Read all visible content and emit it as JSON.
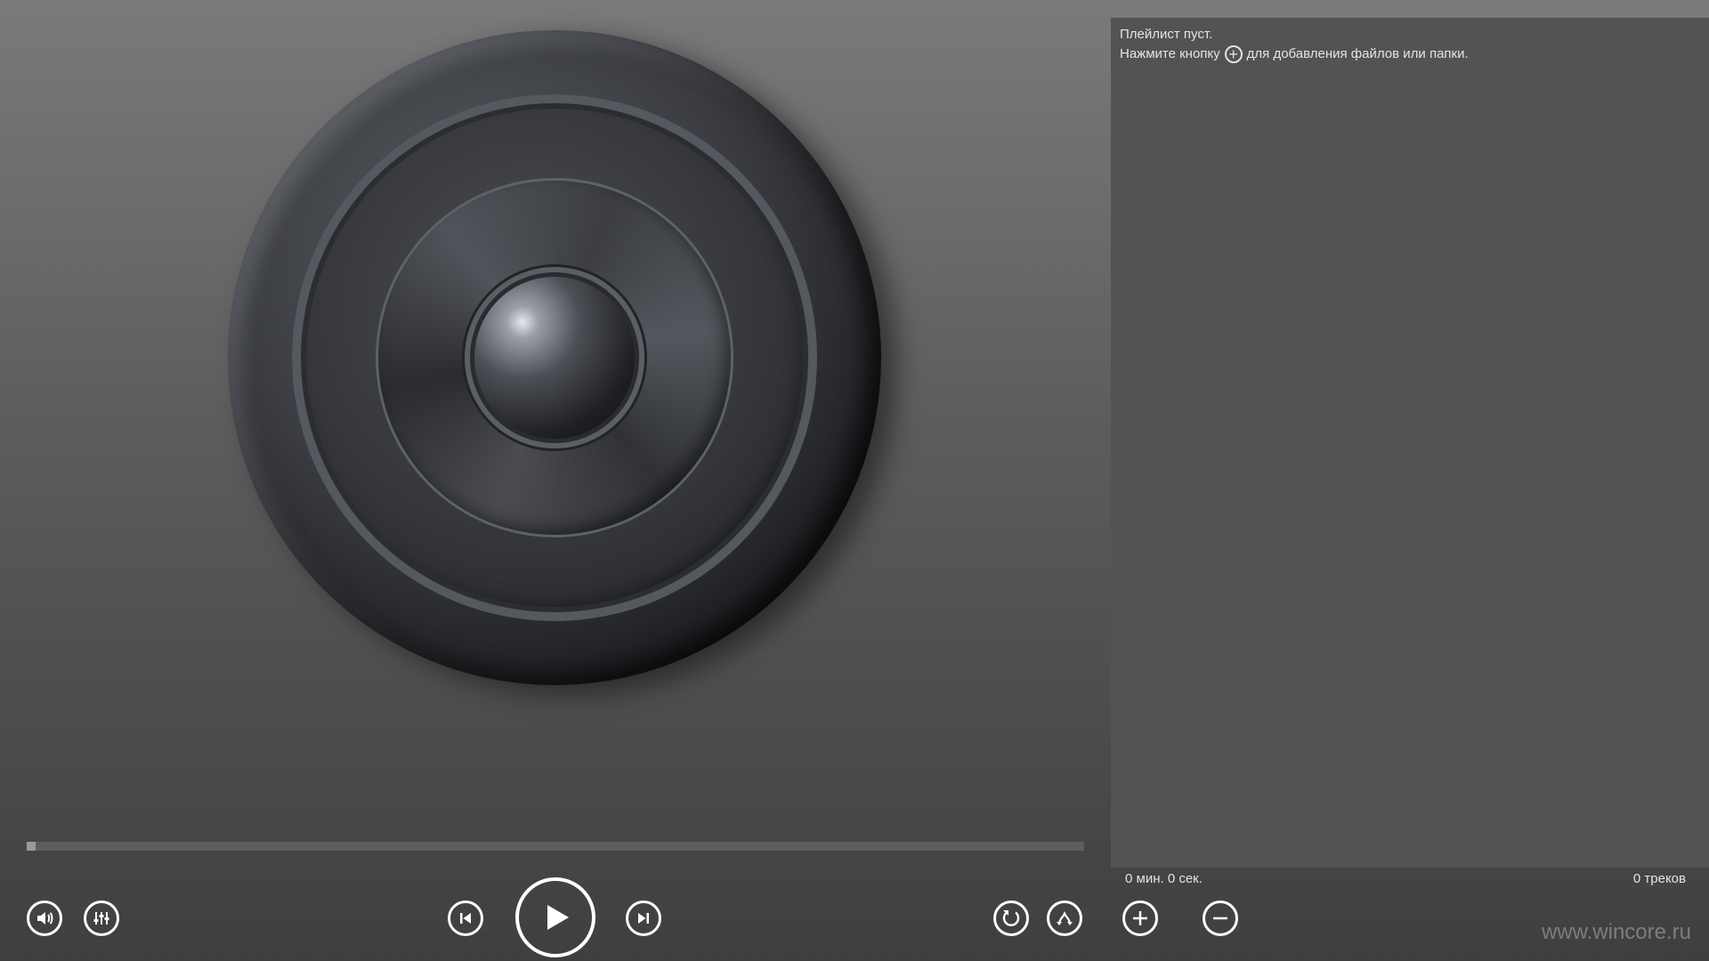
{
  "playlist": {
    "empty_text": "Плейлист пуст.",
    "hint_before": "Нажмите кнопку",
    "hint_icon": "plus-circle-icon",
    "hint_after": "для добавления файлов или папки.",
    "total_time": "0 мин. 0 сек.",
    "track_count": "0 треков"
  },
  "controls": {
    "volume_icon": "volume-icon",
    "equalizer_icon": "equalizer-icon",
    "previous_icon": "previous-track-icon",
    "play_icon": "play-icon",
    "next_icon": "next-track-icon",
    "repeat_icon": "repeat-icon",
    "shuffle_icon": "shuffle-icon",
    "add_icon": "add-icon",
    "remove_icon": "remove-icon"
  },
  "progress": {
    "position": 0
  },
  "watermark": "www.wincore.ru",
  "colors": {
    "panel": "#535353",
    "text": "#e4e4e4",
    "icon": "#ffffff",
    "watermark": "#7d7d7d"
  }
}
